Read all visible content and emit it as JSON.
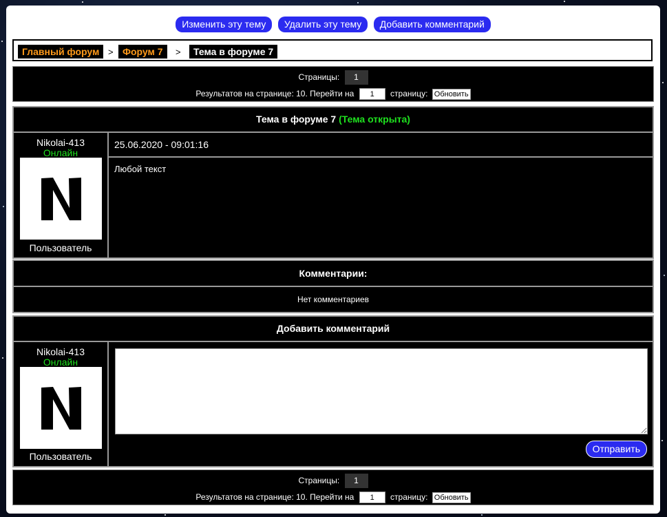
{
  "actions": {
    "edit_topic": "Изменить эту тему",
    "delete_topic": "Удалить эту тему",
    "add_comment": "Добавить комментарий"
  },
  "breadcrumb": {
    "main_forum": "Главный форум",
    "sep1": ">",
    "forum": "Форум 7",
    "sep2": ">",
    "topic": "Тема в форуме 7"
  },
  "pager": {
    "pages_label": "Страницы:",
    "current_page": "1",
    "results_label": "Результатов на странице: 10. Перейти на",
    "goto_value": "1",
    "page_suffix": "страницу:",
    "refresh_label": "Обновить"
  },
  "topic": {
    "title": "Тема в форуме 7",
    "status": "(Тема открыта)",
    "author": "Nikolai-413",
    "author_status": "Онлайн",
    "avatar_letter": "N",
    "author_role": "Пользователь",
    "date": "25.06.2020 - 09:01:16",
    "body": "Любой текст"
  },
  "comments": {
    "header": "Комментарии:",
    "empty": "Нет комментариев"
  },
  "add_comment": {
    "header": "Добавить комментарий",
    "user": "Nikolai-413",
    "user_status": "Онлайн",
    "avatar_letter": "N",
    "user_role": "Пользователь",
    "textarea_value": "",
    "submit_label": "Отправить"
  },
  "colors": {
    "button_blue": "#2b2bf0",
    "breadcrumb_link": "#ff9a1a",
    "online_green": "#1fe11f"
  }
}
